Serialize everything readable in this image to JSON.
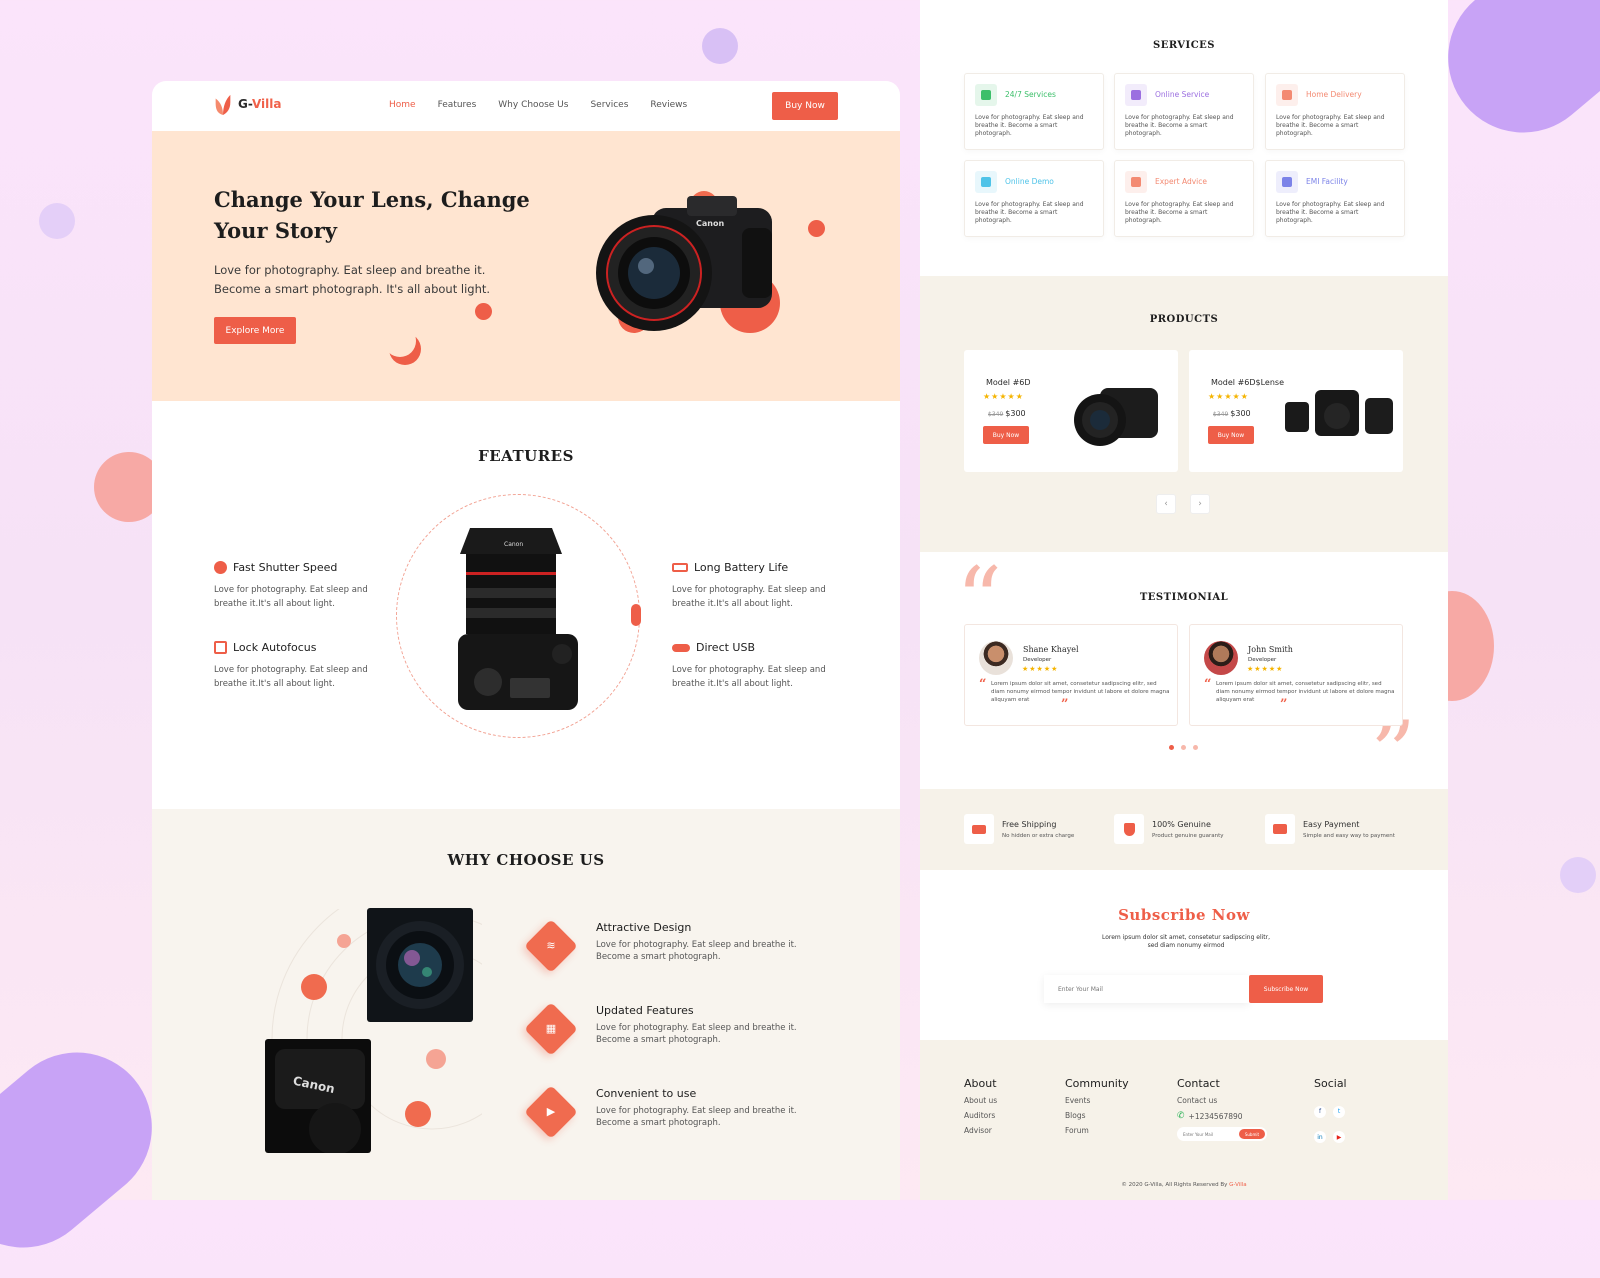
{
  "brand": {
    "name": "G-Villa"
  },
  "nav": {
    "items": [
      {
        "label": "Home"
      },
      {
        "label": "Features"
      },
      {
        "label": "Why Choose Us"
      },
      {
        "label": "Services"
      },
      {
        "label": "Reviews"
      }
    ],
    "buy_label": "Buy Now"
  },
  "hero": {
    "title": "Change Your Lens, Change Your Story",
    "text": "Love for photography. Eat sleep and breathe it. Become a smart photograph. It's all about light.",
    "button": "Explore More"
  },
  "features": {
    "title": "FEATURES",
    "items": [
      {
        "title": "Fast Shutter Speed",
        "text": "Love for photography. Eat sleep and breathe it.It's all about light."
      },
      {
        "title": "Lock Autofocus",
        "text": "Love for photography. Eat sleep and breathe it.It's all about light."
      },
      {
        "title": "Long Battery Life",
        "text": "Love for photography. Eat sleep and breathe it.It's all about light."
      },
      {
        "title": "Direct USB",
        "text": "Love for photography. Eat sleep and breathe it.It's all about light."
      }
    ]
  },
  "why": {
    "title": "WHY CHOOSE US",
    "items": [
      {
        "title": "Attractive Design",
        "text": "Love for photography. Eat sleep and breathe it. Become a smart photograph."
      },
      {
        "title": "Updated Features",
        "text": "Love for photography. Eat sleep and breathe it. Become a smart photograph."
      },
      {
        "title": "Convenient to use",
        "text": "Love for photography. Eat sleep and breathe it. Become a smart photograph."
      }
    ],
    "photo_brand": "Canon"
  },
  "services": {
    "title": "SERVICES",
    "items": [
      {
        "name": "24/7 Services",
        "text": "Love for photography. Eat sleep and breathe it. Become a smart photograph.",
        "color": "#3cbf6a"
      },
      {
        "name": "Online Service",
        "text": "Love for photography. Eat sleep and breathe it. Become a smart photograph.",
        "color": "#9b6fe0"
      },
      {
        "name": "Home Delivery",
        "text": "Love for photography. Eat sleep and breathe it. Become a smart photograph.",
        "color": "#f38a72"
      },
      {
        "name": "Online Demo",
        "text": "Love for photography. Eat sleep and breathe it. Become a smart photograph.",
        "color": "#4fc3e8"
      },
      {
        "name": "Expert Advice",
        "text": "Love for photography. Eat sleep and breathe it. Become a smart photograph.",
        "color": "#f38a72"
      },
      {
        "name": "EMI Facility",
        "text": "Love for photography. Eat sleep and breathe it. Become a smart photograph.",
        "color": "#7c83e8"
      }
    ]
  },
  "products": {
    "title": "PRODUCTS",
    "items": [
      {
        "name": "Model #6D",
        "rating": 5,
        "stars": "★★★★★",
        "old_price": "$349",
        "price": "$300",
        "button": "Buy Now"
      },
      {
        "name": "Model #6D$Lense",
        "rating": 5,
        "stars": "★★★★★",
        "old_price": "$349",
        "price": "$300",
        "button": "Buy Now"
      }
    ],
    "prev": "‹",
    "next": "›"
  },
  "testimonial": {
    "title": "TESTIMONIAL",
    "items": [
      {
        "name": "Shane Khayel",
        "role": "Developer",
        "stars": "★★★★★",
        "text": "Lorem ipsum dolor sit amet, consetetur sadipscing elitr, sed diam nonumy eirmod tempor invidunt ut labore et dolore magna aliquyam erat"
      },
      {
        "name": "John Smith",
        "role": "Developer",
        "stars": "★★★★★",
        "text": "Lorem ipsum dolor sit amet, consetetur sadipscing elitr, sed diam nonumy eirmod tempor invidunt ut labore et dolore magna aliquyam erat"
      }
    ]
  },
  "perks": [
    {
      "title": "Free Shipping",
      "sub": "No hidden or extra charge"
    },
    {
      "title": "100% Genuine",
      "sub": "Product genuine guaranty"
    },
    {
      "title": "Easy Payment",
      "sub": "Simple and easy way to payment"
    }
  ],
  "subscribe": {
    "title": "Subscribe Now",
    "text": "Lorem ipsum dolor sit amet, consetetur sadipscing elitr, sed diam nonumy eirmod",
    "placeholder": "Enter Your Mail",
    "button": "Subscribe Now"
  },
  "footer": {
    "about": {
      "title": "About",
      "links": [
        "About us",
        "Auditors",
        "Advisor"
      ]
    },
    "community": {
      "title": "Community",
      "links": [
        "Events",
        "Blogs",
        "Forum"
      ]
    },
    "contact": {
      "title": "Contact",
      "link": "Contact us",
      "phone": "+1234567890",
      "placeholder": "Enter Your Mail",
      "button": "Submit"
    },
    "social": {
      "title": "Social",
      "icons": [
        "facebook-icon",
        "twitter-icon",
        "linkedin-icon",
        "youtube-icon"
      ]
    },
    "copyright": "© 2020 G-Villa, All Rights Reserved By",
    "copyright_brand": "G-Villa"
  },
  "colors": {
    "accent": "#ee5e48",
    "hero_bg": "#ffe5d1",
    "cream": "#f6f2e9",
    "bg": "#fbe4fb"
  }
}
